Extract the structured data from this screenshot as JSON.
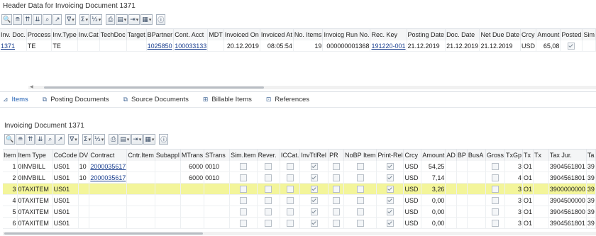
{
  "header": {
    "title": "Header Data for Invoicing Document 1371",
    "toolbar": [
      {
        "name": "zoom",
        "glyph": "🔍",
        "dd": false
      },
      {
        "name": "align",
        "glyph": "≘",
        "dd": false
      },
      {
        "name": "sort-asc",
        "glyph": "⇈",
        "dd": false
      },
      {
        "name": "sort-desc",
        "glyph": "⇊",
        "dd": false
      },
      {
        "name": "find",
        "glyph": "⌕",
        "dd": false
      },
      {
        "name": "find-next",
        "glyph": "↗",
        "dd": false
      },
      {
        "name": "filter",
        "glyph": "∇",
        "dd": true
      },
      {
        "name": "sum",
        "glyph": "Σ",
        "dd": true
      },
      {
        "name": "subtotal",
        "glyph": "½",
        "dd": true
      },
      {
        "name": "print",
        "glyph": "⎙",
        "dd": false
      },
      {
        "name": "view",
        "glyph": "▤",
        "dd": true
      },
      {
        "name": "export",
        "glyph": "⇥",
        "dd": true
      },
      {
        "name": "layout",
        "glyph": "▦",
        "dd": true
      },
      {
        "name": "info",
        "glyph": "ⓘ",
        "dd": false
      }
    ],
    "columns": [
      "Inv. Doc.",
      "Process",
      "Inv.Type",
      "Inv.Cat",
      "TechDoc",
      "Target",
      "BPartner",
      "Cont. Acct",
      "MDT",
      "Invoiced On",
      "Invoiced At",
      "No. Items",
      "Invoicg Run No.",
      "Rec. Key",
      "Posting Date",
      "Doc. Date",
      "Net Due Date",
      "Crcy",
      "Amount",
      "Posted",
      "Sim"
    ],
    "row": [
      "1371",
      "TE",
      "TE",
      "",
      "",
      "",
      "1025850",
      "100033133",
      "",
      "20.12.2019",
      "08:05:54",
      "19",
      "000000001368",
      "191220-001",
      "21.12.2019",
      "21.12.2019",
      "21.12.2019",
      "USD",
      "65,08",
      "",
      ""
    ],
    "row_posted": true
  },
  "tabs": [
    {
      "label": "Items",
      "icon": "items-icon",
      "glyph": "⊿",
      "active": true
    },
    {
      "label": "Posting Documents",
      "icon": "documents-icon",
      "glyph": "⧉",
      "active": false
    },
    {
      "label": "Source Documents",
      "icon": "source-icon",
      "glyph": "⧉",
      "active": false
    },
    {
      "label": "Billable Items",
      "icon": "billable-icon",
      "glyph": "⊞",
      "active": false
    },
    {
      "label": "References",
      "icon": "references-icon",
      "glyph": "⊡",
      "active": false
    }
  ],
  "items": {
    "title": "Invoicing Document 1371",
    "columns": [
      "Item",
      "Item Type",
      "CoCode",
      "DV",
      "Contract",
      "Cntr.Item",
      "Subappl",
      "MTrans",
      "STrans",
      "Sim.Item",
      "Rever.",
      "ICCat.",
      "InvTtlRel",
      "PR",
      "NoBP Item",
      "Print-Rel",
      "Crcy",
      "Amount",
      "AD",
      "BP",
      "BusA",
      "Gross",
      "TxGp",
      "Tx",
      "Tx",
      "Tax Jur.",
      "Ta"
    ],
    "rows": [
      {
        "item": "1",
        "type": "0INVBILL",
        "cocode": "US01",
        "dv": "10",
        "contract": "2000035617",
        "cntr": "",
        "subappl": "",
        "mtrans": "6000",
        "strans": "0010",
        "inv": true,
        "print": true,
        "crcy": "USD",
        "amount": "54,25",
        "txgp": "3",
        "tx": "O1",
        "taxjur": "3904561801",
        "ta": "39"
      },
      {
        "item": "2",
        "type": "0INVBILL",
        "cocode": "US01",
        "dv": "10",
        "contract": "2000035617",
        "cntr": "",
        "subappl": "",
        "mtrans": "6000",
        "strans": "0010",
        "inv": true,
        "print": true,
        "crcy": "USD",
        "amount": "7,14",
        "txgp": "4",
        "tx": "O1",
        "taxjur": "3904561801",
        "ta": "39"
      },
      {
        "item": "3",
        "type": "0TAXITEM",
        "cocode": "US01",
        "dv": "",
        "contract": "",
        "cntr": "",
        "subappl": "",
        "mtrans": "",
        "strans": "",
        "inv": true,
        "print": true,
        "crcy": "USD",
        "amount": "3,26",
        "txgp": "3",
        "tx": "O1",
        "taxjur": "3900000000",
        "ta": "39",
        "highlight": true
      },
      {
        "item": "4",
        "type": "0TAXITEM",
        "cocode": "US01",
        "dv": "",
        "contract": "",
        "cntr": "",
        "subappl": "",
        "mtrans": "",
        "strans": "",
        "inv": true,
        "print": true,
        "crcy": "USD",
        "amount": "0,00",
        "txgp": "3",
        "tx": "O1",
        "taxjur": "3904500000",
        "ta": "39"
      },
      {
        "item": "5",
        "type": "0TAXITEM",
        "cocode": "US01",
        "dv": "",
        "contract": "",
        "cntr": "",
        "subappl": "",
        "mtrans": "",
        "strans": "",
        "inv": true,
        "print": true,
        "crcy": "USD",
        "amount": "0,00",
        "txgp": "3",
        "tx": "O1",
        "taxjur": "3904561800",
        "ta": "39"
      },
      {
        "item": "6",
        "type": "0TAXITEM",
        "cocode": "US01",
        "dv": "",
        "contract": "",
        "cntr": "",
        "subappl": "",
        "mtrans": "",
        "strans": "",
        "inv": true,
        "print": true,
        "crcy": "USD",
        "amount": "0,00",
        "txgp": "3",
        "tx": "O1",
        "taxjur": "3904561801",
        "ta": "39"
      }
    ]
  },
  "colors": {
    "highlight": "#f3f59a",
    "link": "#1a3f8f",
    "tab_active": "#1f5fb4"
  }
}
